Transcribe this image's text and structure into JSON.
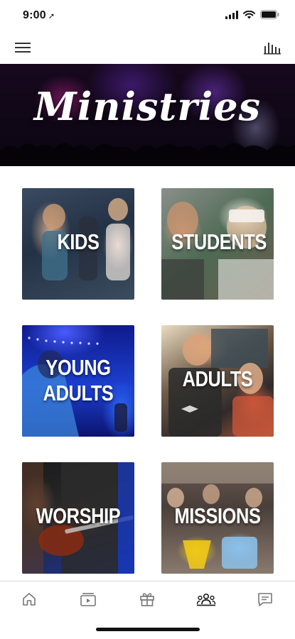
{
  "status_bar": {
    "time": "9:00",
    "location_glyph": "➚"
  },
  "nav": {
    "menu_icon": "hamburger-menu-icon",
    "stats_icon": "bar-chart-icon"
  },
  "hero": {
    "title": "Ministries"
  },
  "tiles": [
    {
      "label_lines": [
        "KIDS"
      ]
    },
    {
      "label_lines": [
        "STUDENTS"
      ]
    },
    {
      "label_lines": [
        "YOUNG",
        "ADULTS"
      ]
    },
    {
      "label_lines": [
        "ADULTS"
      ]
    },
    {
      "label_lines": [
        "WORSHIP"
      ]
    },
    {
      "label_lines": [
        "MISSIONS"
      ]
    }
  ],
  "tab_bar": {
    "tabs": [
      "home-icon",
      "media-icon",
      "gift-icon",
      "groups-icon",
      "message-icon"
    ],
    "active_index": 3
  }
}
